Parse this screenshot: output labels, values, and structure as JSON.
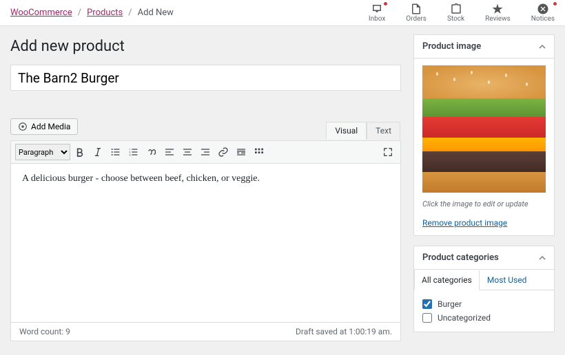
{
  "breadcrumb": {
    "a": "WooCommerce",
    "b": "Products",
    "c": "Add New"
  },
  "toptabs": {
    "inbox": "Inbox",
    "orders": "Orders",
    "stock": "Stock",
    "reviews": "Reviews",
    "notices": "Notices"
  },
  "page_title": "Add new product",
  "product_title": "The Barn2 Burger",
  "media_btn": "Add Media",
  "editor_tabs": {
    "visual": "Visual",
    "text": "Text"
  },
  "paragraph_select": "Paragraph",
  "editor_body": "A delicious burger - choose between beef, chicken, or veggie.",
  "footer": {
    "wc": "Word count: 9",
    "status": "Draft saved at 1:00:19 am."
  },
  "panel_img": {
    "title": "Product image",
    "hint": "Click the image to edit or update",
    "remove": "Remove product image"
  },
  "panel_cat": {
    "title": "Product categories",
    "tab_all": "All categories",
    "tab_most": "Most Used",
    "items": [
      {
        "label": "Burger",
        "checked": true
      },
      {
        "label": "Uncategorized",
        "checked": false
      }
    ]
  }
}
